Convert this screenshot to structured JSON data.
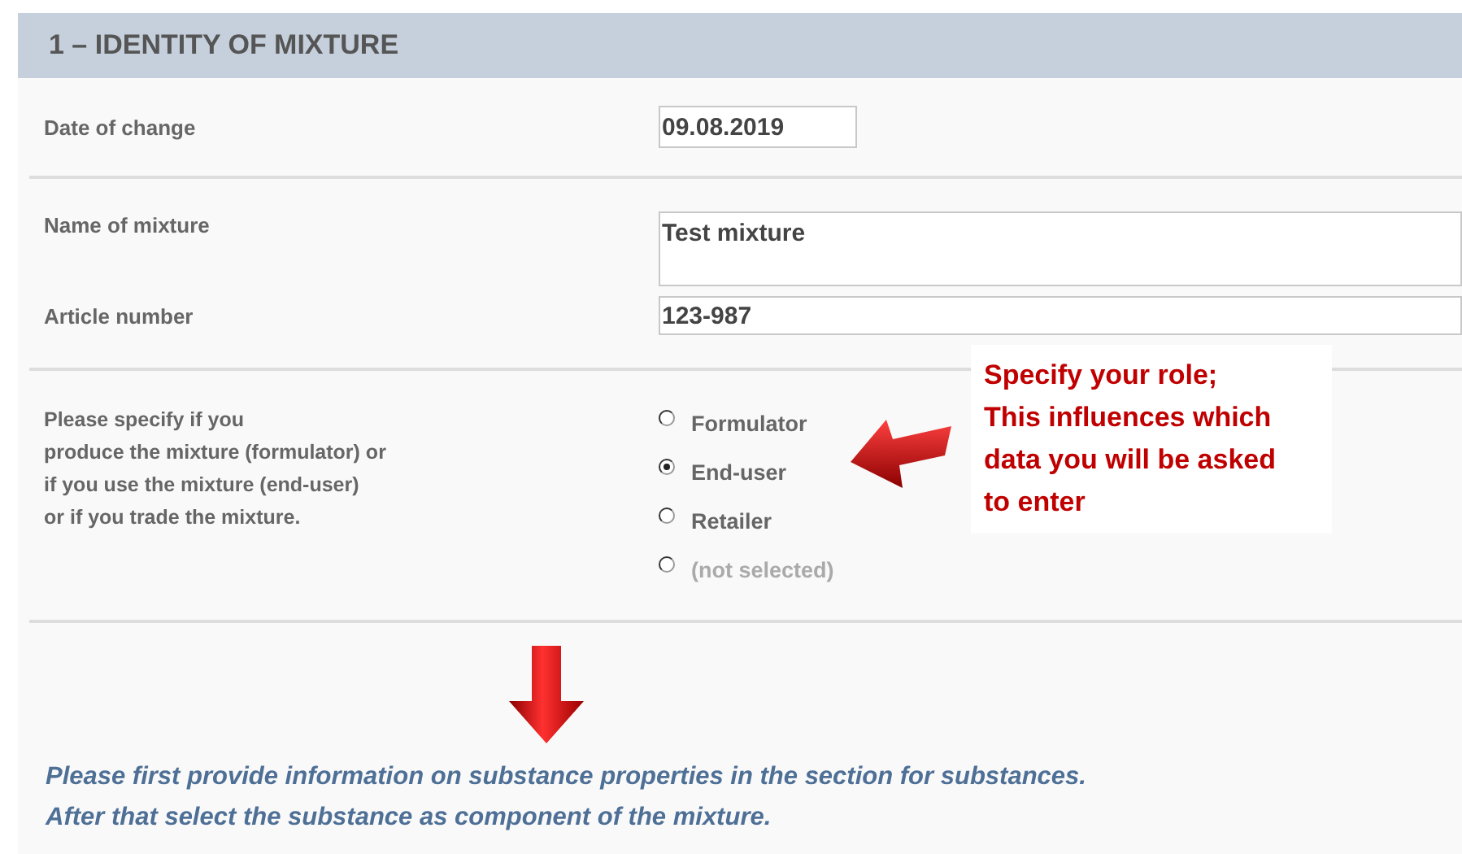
{
  "section": {
    "title": "1 – IDENTITY OF MIXTURE"
  },
  "fields": [
    {
      "label": "Date of change",
      "value": "09.08.2019",
      "kind": "short"
    },
    {
      "label": "Name of mixture",
      "value": "Test mixture",
      "kind": "area"
    },
    {
      "label": "Article number",
      "value": "123-987",
      "kind": "wide"
    }
  ],
  "role": {
    "label": "Please specify if you\nproduce the mixture (formulator) or\nif you use the mixture (end-user)\nor if you trade the mixture.",
    "options": [
      {
        "label": "Formulator",
        "selected": false,
        "dimmed": false
      },
      {
        "label": "End-user",
        "selected": true,
        "dimmed": false
      },
      {
        "label": "Retailer",
        "selected": false,
        "dimmed": false
      },
      {
        "label": "(not selected)",
        "selected": false,
        "dimmed": true
      }
    ]
  },
  "callout": {
    "text": "Specify your role;\nThis influences which\ndata you will be asked\nto enter"
  },
  "note": {
    "text": "Please first provide information on substance properties in the section for substances.\nAfter that select the substance as component of the mixture."
  }
}
